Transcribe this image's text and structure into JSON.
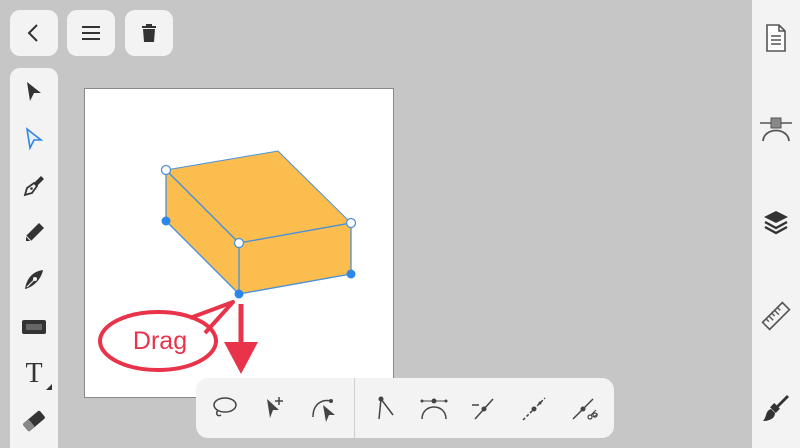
{
  "top_bar": {
    "back_icon": "chevron-left-icon",
    "menu_icon": "hamburger-menu-icon",
    "delete_icon": "trash-icon"
  },
  "left_toolbar": {
    "tools": [
      {
        "name": "selection-tool",
        "icon": "arrow-pointer-icon"
      },
      {
        "name": "direct-selection-tool",
        "icon": "hollow-arrow-pointer-icon",
        "active": true
      },
      {
        "name": "pen-tool",
        "icon": "pen-nib-icon"
      },
      {
        "name": "pencil-tool",
        "icon": "pencil-icon"
      },
      {
        "name": "brush-tool",
        "icon": "brush-nib-icon"
      },
      {
        "name": "shape-tool",
        "icon": "shape-icon"
      },
      {
        "name": "text-tool",
        "icon": "text-icon",
        "label": "T"
      },
      {
        "name": "eraser-tool",
        "icon": "eraser-icon"
      }
    ]
  },
  "right_panel": {
    "items": [
      {
        "name": "document-panel",
        "icon": "document-icon"
      },
      {
        "name": "path-panel",
        "icon": "bezier-path-icon"
      },
      {
        "name": "layers-panel",
        "icon": "layers-icon"
      },
      {
        "name": "ruler-panel",
        "icon": "ruler-icon"
      },
      {
        "name": "style-panel",
        "icon": "paint-brush-icon"
      }
    ]
  },
  "bottom_toolbar": {
    "tools": [
      {
        "name": "lasso-select",
        "icon": "lasso-icon"
      },
      {
        "name": "add-anchor-select",
        "icon": "arrow-plus-icon"
      },
      {
        "name": "curve-select",
        "icon": "curve-arrow-icon"
      },
      {
        "name": "corner-point",
        "icon": "corner-point-icon"
      },
      {
        "name": "smooth-point",
        "icon": "smooth-point-icon"
      },
      {
        "name": "break-handle",
        "icon": "break-handle-icon"
      },
      {
        "name": "join-point",
        "icon": "join-point-icon"
      },
      {
        "name": "cut-path",
        "icon": "scissors-path-icon"
      }
    ]
  },
  "canvas": {
    "shape_fill": "#fbbe4e",
    "selection_color": "#4a90d9",
    "anchor_color": "#2f86ea"
  },
  "annotation": {
    "label": "Drag",
    "color": "#e8334a"
  }
}
